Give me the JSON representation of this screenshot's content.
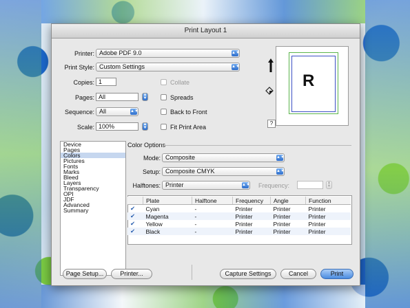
{
  "window": {
    "title": "Print Layout 1"
  },
  "fields": {
    "printer": {
      "label": "Printer:",
      "value": "Adobe PDF 9.0"
    },
    "print_style": {
      "label": "Print Style:",
      "value": "Custom Settings"
    },
    "copies": {
      "label": "Copies:",
      "value": "1"
    },
    "pages": {
      "label": "Pages:",
      "value": "All"
    },
    "sequence": {
      "label": "Sequence:",
      "value": "All"
    },
    "scale": {
      "label": "Scale:",
      "value": "100%"
    }
  },
  "checkboxes": {
    "collate": "Collate",
    "spreads": "Spreads",
    "back_to_front": "Back to Front",
    "fit_print_area": "Fit Print Area"
  },
  "preview": {
    "letter": "R",
    "help": "?"
  },
  "sidebar": {
    "items": [
      "Device",
      "Pages",
      "Colors",
      "Pictures",
      "Fonts",
      "Marks",
      "Bleed",
      "Layers",
      "Transparency",
      "OPI",
      "JDF",
      "Advanced",
      "Summary"
    ],
    "selected": "Colors"
  },
  "color_options": {
    "title": "Color Options",
    "mode": {
      "label": "Mode:",
      "value": "Composite"
    },
    "setup": {
      "label": "Setup:",
      "value": "Composite CMYK"
    },
    "halftones": {
      "label": "Halftones:",
      "value": "Printer"
    },
    "frequency": {
      "label": "Frequency:",
      "value": ""
    }
  },
  "plates_table": {
    "headers": [
      "Plate",
      "Halftone",
      "Frequency",
      "Angle",
      "Function"
    ],
    "rows": [
      {
        "plate": "Cyan",
        "halftone": "-",
        "frequency": "Printer",
        "angle": "Printer",
        "function": "Printer"
      },
      {
        "plate": "Magenta",
        "halftone": "-",
        "frequency": "Printer",
        "angle": "Printer",
        "function": "Printer"
      },
      {
        "plate": "Yellow",
        "halftone": "-",
        "frequency": "Printer",
        "angle": "Printer",
        "function": "Printer"
      },
      {
        "plate": "Black",
        "halftone": "-",
        "frequency": "Printer",
        "angle": "Printer",
        "function": "Printer"
      }
    ]
  },
  "buttons": {
    "page_setup": "Page Setup...",
    "printer": "Printer...",
    "capture_settings": "Capture Settings",
    "cancel": "Cancel",
    "print": "Print"
  },
  "colors": {
    "accent": "#3a7ee0",
    "background_blue": "#1b67c9",
    "background_green": "#7ac943"
  }
}
